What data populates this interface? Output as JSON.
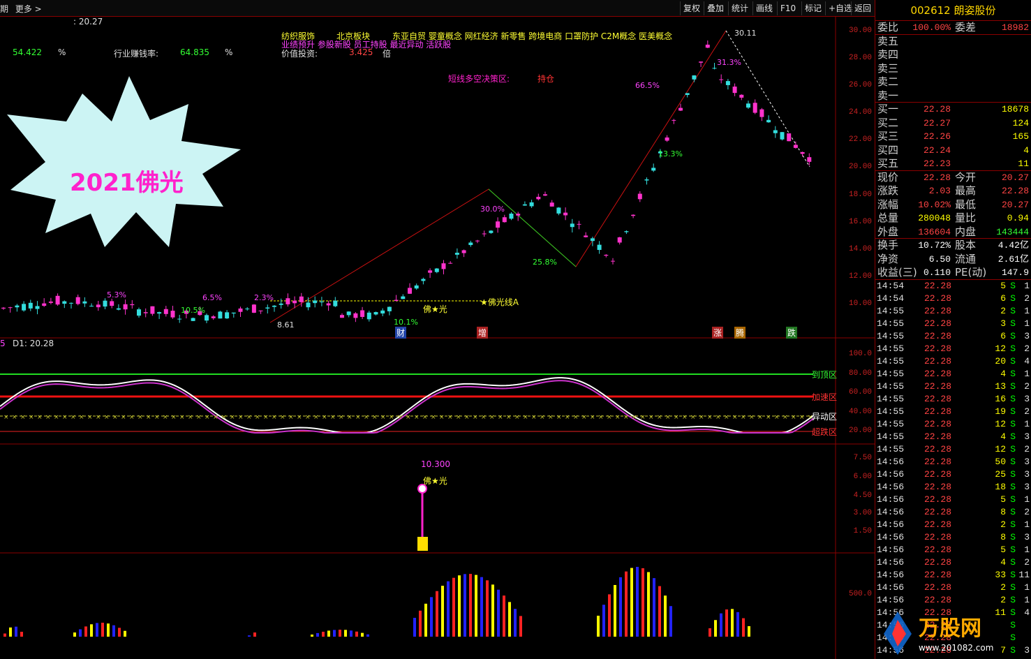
{
  "toolbar": {
    "left_items": [
      "期",
      "更多 >"
    ],
    "buttons": [
      "复权",
      "叠加",
      "统计",
      "画线",
      "F10",
      "标记",
      "+自选",
      "返回"
    ]
  },
  "main_chart": {
    "cursor_value": ": 20.27",
    "info_left_value1": "54.422",
    "info_left_unit1": "%",
    "info_label2": "行业赚钱率:",
    "info_value2": "64.835",
    "info_unit2": "%",
    "concepts_line1_a": "纺织服饰",
    "concepts_line1_b": "北京板块",
    "concepts_line1_c": "东亚自贸 婴童概念 网红经济 新零售 跨境电商 口罩防护 C2M概念 医美概念",
    "concepts_line2": "业绩预升 参股新股 员工持股 最近异动 活跃股",
    "value_label": "价值投资:",
    "value_num": "3.425",
    "value_unit": "倍",
    "decision_label": "短线多空决策区:",
    "decision_value": "持仓",
    "burst_text": "2021佛光",
    "price_high": "30.11",
    "price_low": "8.61",
    "foguang_line": "★佛光线A",
    "foguang_mark": "佛★光",
    "pct_labels": [
      "5.3%",
      "10.5%",
      "6.5%",
      "2.3%",
      "10.1%",
      "30.0%",
      "25.8%",
      "66.5%",
      "13.3%",
      "31.3%"
    ],
    "event_tags": [
      "财",
      "增",
      "涨",
      "腾",
      "跌"
    ],
    "y_axis": [
      "30.00",
      "28.00",
      "26.00",
      "24.00",
      "22.00",
      "20.00",
      "18.00",
      "16.00",
      "14.00",
      "12.00",
      "10.00"
    ]
  },
  "osc_panel": {
    "title_num": "5",
    "title": "D1: 20.28",
    "zone_top": "到顶区",
    "zone_speed": "加速区",
    "zone_move": "异动区",
    "zone_drop": "超跌区",
    "y_axis": [
      "100.0",
      "80.00",
      "60.00",
      "40.00",
      "20.00"
    ]
  },
  "signal_panel": {
    "value": "10.300",
    "mark": "佛★光",
    "y_axis": [
      "7.50",
      "6.00",
      "4.50",
      "3.00",
      "1.50"
    ]
  },
  "volume_panel": {
    "y_axis": [
      "500.0"
    ]
  },
  "quote": {
    "code": "002612",
    "name": "朗姿股份",
    "weibi_label": "委比",
    "weibi": "100.00%",
    "weicha_label": "委差",
    "weicha": "18982",
    "sell": [
      {
        "label": "卖五",
        "price": "",
        "vol": ""
      },
      {
        "label": "卖四",
        "price": "",
        "vol": ""
      },
      {
        "label": "卖三",
        "price": "",
        "vol": ""
      },
      {
        "label": "卖二",
        "price": "",
        "vol": ""
      },
      {
        "label": "卖一",
        "price": "",
        "vol": ""
      }
    ],
    "buy": [
      {
        "label": "买一",
        "price": "22.28",
        "vol": "18678"
      },
      {
        "label": "买二",
        "price": "22.27",
        "vol": "124"
      },
      {
        "label": "买三",
        "price": "22.26",
        "vol": "165"
      },
      {
        "label": "买四",
        "price": "22.24",
        "vol": "4"
      },
      {
        "label": "买五",
        "price": "22.23",
        "vol": "11"
      }
    ],
    "stats": [
      {
        "l1": "现价",
        "v1": "22.28",
        "l2": "今开",
        "v2": "20.27"
      },
      {
        "l1": "涨跌",
        "v1": "2.03",
        "l2": "最高",
        "v2": "22.28"
      },
      {
        "l1": "涨幅",
        "v1": "10.02%",
        "l2": "最低",
        "v2": "20.27"
      },
      {
        "l1": "总量",
        "v1": "280048",
        "l2": "量比",
        "v2": "0.94"
      },
      {
        "l1": "外盘",
        "v1": "136604",
        "l2": "内盘",
        "v2": "143444"
      }
    ],
    "stats2": [
      {
        "l1": "换手",
        "v1": "10.72%",
        "l2": "股本",
        "v2": "4.42亿"
      },
      {
        "l1": "净资",
        "v1": "6.50",
        "l2": "流通",
        "v2": "2.61亿"
      },
      {
        "l1": "收益(三)",
        "v1": "0.110",
        "l2": "PE(动)",
        "v2": "147.9"
      }
    ],
    "ticks": [
      [
        "14:54",
        "22.28",
        "5",
        "S",
        "1"
      ],
      [
        "14:54",
        "22.28",
        "6",
        "S",
        "2"
      ],
      [
        "14:55",
        "22.28",
        "2",
        "S",
        "1"
      ],
      [
        "14:55",
        "22.28",
        "3",
        "S",
        "1"
      ],
      [
        "14:55",
        "22.28",
        "6",
        "S",
        "3"
      ],
      [
        "14:55",
        "22.28",
        "12",
        "S",
        "2"
      ],
      [
        "14:55",
        "22.28",
        "20",
        "S",
        "4"
      ],
      [
        "14:55",
        "22.28",
        "4",
        "S",
        "1"
      ],
      [
        "14:55",
        "22.28",
        "13",
        "S",
        "2"
      ],
      [
        "14:55",
        "22.28",
        "16",
        "S",
        "3"
      ],
      [
        "14:55",
        "22.28",
        "19",
        "S",
        "2"
      ],
      [
        "14:55",
        "22.28",
        "12",
        "S",
        "1"
      ],
      [
        "14:55",
        "22.28",
        "4",
        "S",
        "3"
      ],
      [
        "14:55",
        "22.28",
        "12",
        "S",
        "2"
      ],
      [
        "14:56",
        "22.28",
        "50",
        "S",
        "3"
      ],
      [
        "14:56",
        "22.28",
        "25",
        "S",
        "3"
      ],
      [
        "14:56",
        "22.28",
        "18",
        "S",
        "3"
      ],
      [
        "14:56",
        "22.28",
        "5",
        "S",
        "1"
      ],
      [
        "14:56",
        "22.28",
        "8",
        "S",
        "2"
      ],
      [
        "14:56",
        "22.28",
        "2",
        "S",
        "1"
      ],
      [
        "14:56",
        "22.28",
        "8",
        "S",
        "3"
      ],
      [
        "14:56",
        "22.28",
        "5",
        "S",
        "1"
      ],
      [
        "14:56",
        "22.28",
        "4",
        "S",
        "2"
      ],
      [
        "14:56",
        "22.28",
        "33",
        "S",
        "11"
      ],
      [
        "14:56",
        "22.28",
        "2",
        "S",
        "1"
      ],
      [
        "14:56",
        "22.28",
        "2",
        "S",
        "1"
      ],
      [
        "14:56",
        "22.28",
        "11",
        "S",
        "4"
      ],
      [
        "14:56",
        "22.28",
        "",
        "S",
        ""
      ],
      [
        "14:56",
        "22.28",
        "",
        "S",
        ""
      ],
      [
        "14:56",
        "22.28",
        "7",
        "S",
        "3"
      ]
    ]
  },
  "watermark": "万股网",
  "watermark_url": "www.201082.com"
}
